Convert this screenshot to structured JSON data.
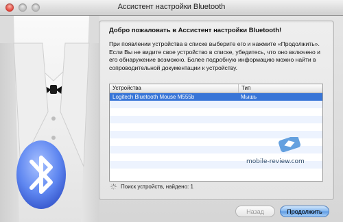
{
  "window": {
    "title": "Ассистент настройки Bluetooth"
  },
  "content": {
    "heading": "Добро пожаловать в Ассистент настройки Bluetooth!",
    "description": "При появлении устройства в списке выберите его и нажмите «Продолжить». Если Вы не видите свое устройство в списке, убедитесь, что оно включено и его обнаружение возможно. Более подробную информацию можно найти в сопроводительной документации к устройству."
  },
  "device_table": {
    "columns": [
      "Устройства",
      "Тип"
    ],
    "rows": [
      {
        "device": "Logitech Bluetooth Mouse M555b",
        "type": "Мышь",
        "selected": true
      }
    ]
  },
  "status": {
    "text": "Поиск устройств, найдено: 1"
  },
  "buttons": {
    "back": "Назад",
    "continue": "Продолжить"
  },
  "watermark": {
    "text": "mobile-review.com"
  },
  "colors": {
    "selection": "#3875d7",
    "row_alt": "#edf3fe",
    "primary_button": "#5d9ae3",
    "bluetooth_blue": "#3f6fe6"
  },
  "icons": {
    "artwork": "tuxedo-illustration",
    "bluetooth": "bluetooth-icon",
    "spinner": "spinner-icon"
  }
}
